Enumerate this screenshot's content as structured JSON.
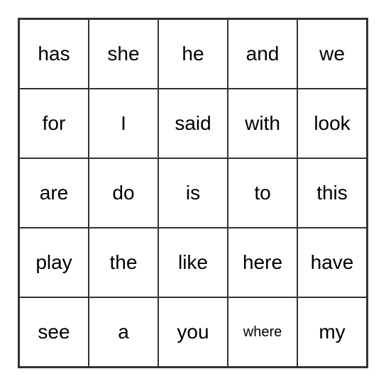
{
  "grid": [
    [
      {
        "word": "has",
        "small": false
      },
      {
        "word": "she",
        "small": false
      },
      {
        "word": "he",
        "small": false
      },
      {
        "word": "and",
        "small": false
      },
      {
        "word": "we",
        "small": false
      }
    ],
    [
      {
        "word": "for",
        "small": false
      },
      {
        "word": "I",
        "small": false
      },
      {
        "word": "said",
        "small": false
      },
      {
        "word": "with",
        "small": false
      },
      {
        "word": "look",
        "small": false
      }
    ],
    [
      {
        "word": "are",
        "small": false
      },
      {
        "word": "do",
        "small": false
      },
      {
        "word": "is",
        "small": false
      },
      {
        "word": "to",
        "small": false
      },
      {
        "word": "this",
        "small": false
      }
    ],
    [
      {
        "word": "play",
        "small": false
      },
      {
        "word": "the",
        "small": false
      },
      {
        "word": "like",
        "small": false
      },
      {
        "word": "here",
        "small": false
      },
      {
        "word": "have",
        "small": false
      }
    ],
    [
      {
        "word": "see",
        "small": false
      },
      {
        "word": "a",
        "small": false
      },
      {
        "word": "you",
        "small": false
      },
      {
        "word": "where",
        "small": true
      },
      {
        "word": "my",
        "small": false
      }
    ]
  ]
}
